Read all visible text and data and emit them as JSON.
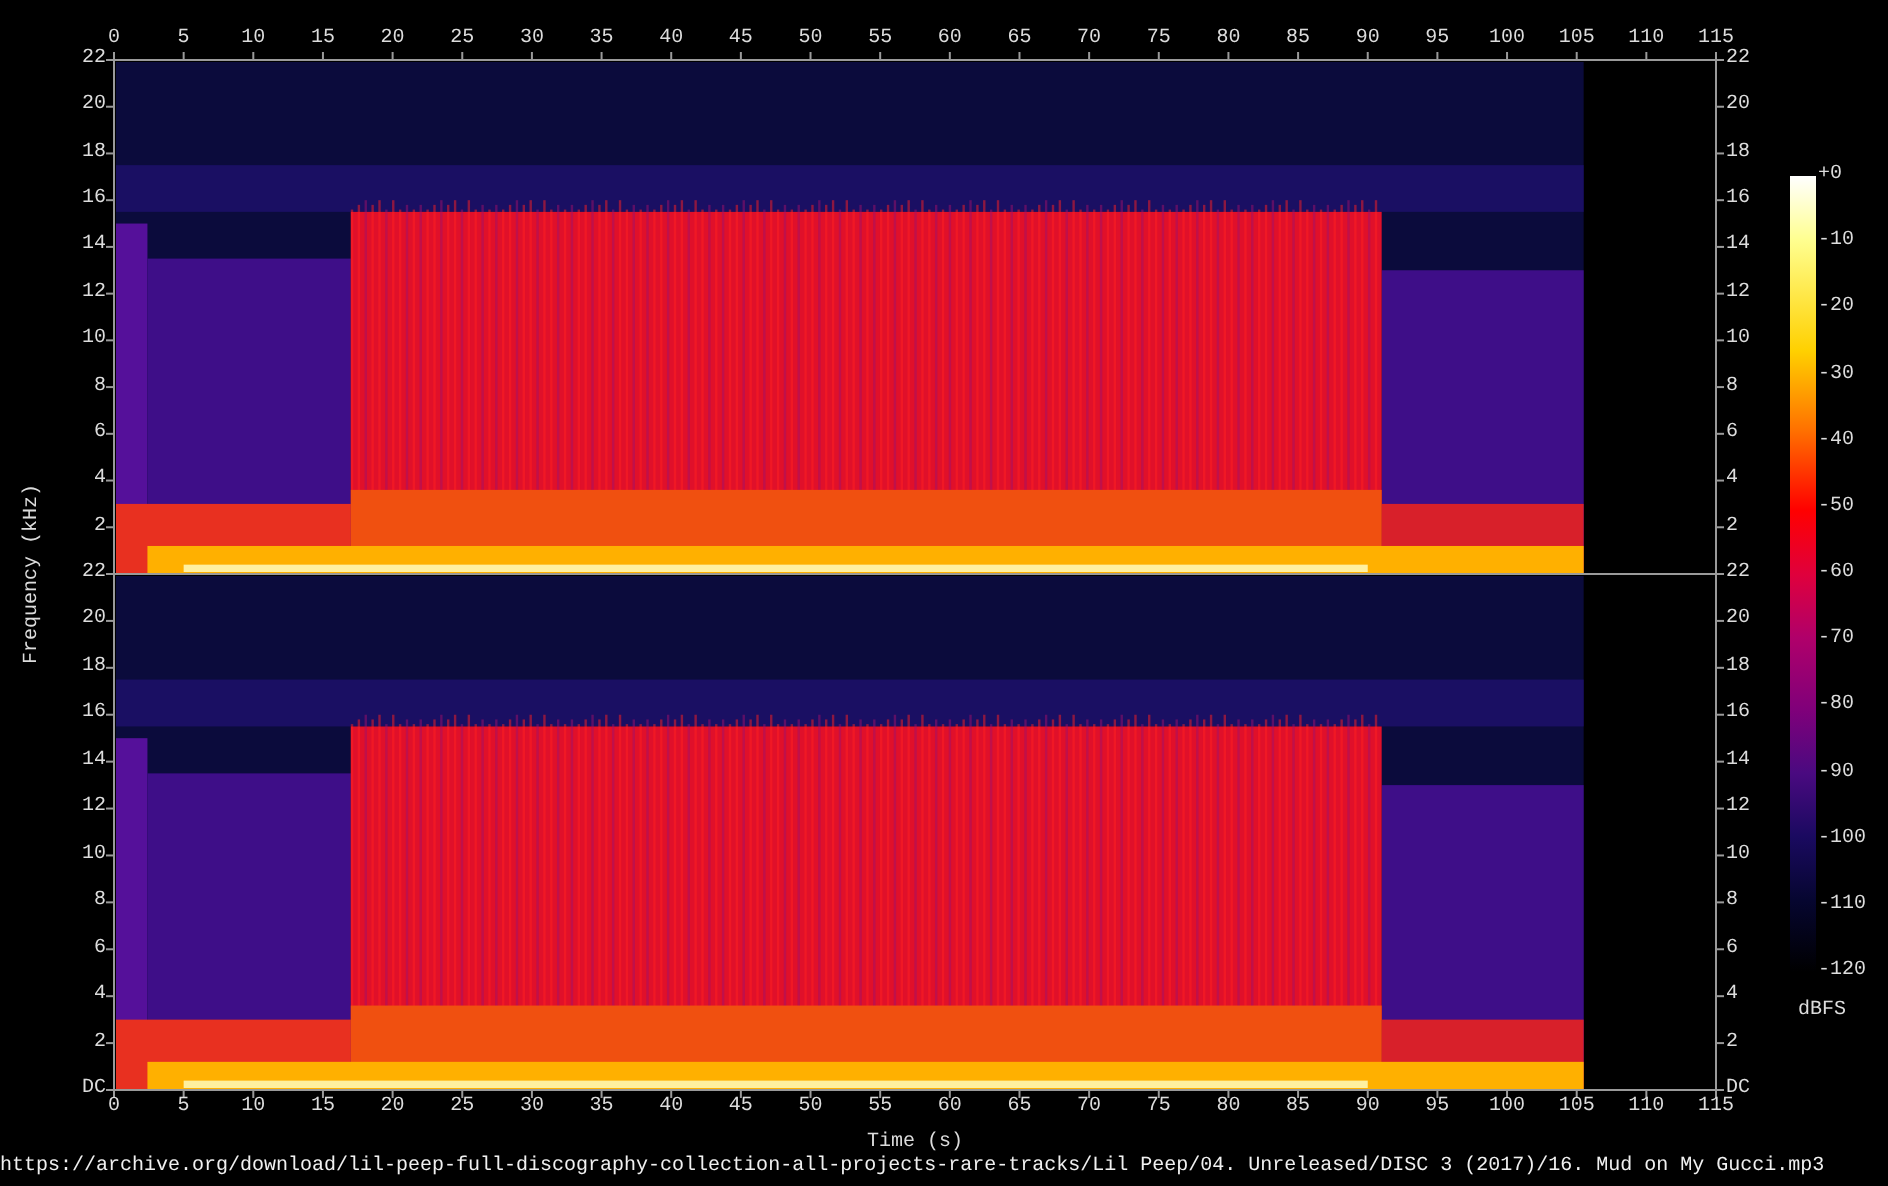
{
  "time_axis_top": {
    "ticks": [
      "0",
      "5",
      "10",
      "15",
      "20",
      "25",
      "30",
      "35",
      "40",
      "45",
      "50",
      "55",
      "60",
      "65",
      "70",
      "75",
      "80",
      "85",
      "90",
      "95",
      "100",
      "105",
      "110",
      "115"
    ]
  },
  "frequency_axis": {
    "label": "Frequency (kHz)",
    "channels": [
      {
        "left_ticks": [
          "22",
          "20",
          "18",
          "16",
          "14",
          "12",
          "10",
          "8",
          "6",
          "4",
          "2"
        ],
        "right_ticks": [
          "22",
          "20",
          "18",
          "16",
          "14",
          "12",
          "10",
          "8",
          "6",
          "4",
          "2"
        ]
      },
      {
        "left_ticks": [
          "22",
          "20",
          "18",
          "16",
          "14",
          "12",
          "10",
          "8",
          "6",
          "4",
          "2",
          "DC"
        ],
        "right_ticks": [
          "22",
          "20",
          "18",
          "16",
          "14",
          "12",
          "10",
          "8",
          "6",
          "4",
          "2",
          "DC"
        ]
      }
    ]
  },
  "colorbar": {
    "ticks": [
      "+0",
      "-10",
      "-20",
      "-30",
      "-40",
      "-50",
      "-60",
      "-70",
      "-80",
      "-90",
      "-100",
      "-110",
      "-120"
    ],
    "unit": "dBFS"
  },
  "time_axis_bottom": {
    "ticks": [
      "0",
      "5",
      "10",
      "15",
      "20",
      "25",
      "30",
      "35",
      "40",
      "45",
      "50",
      "55",
      "60",
      "65",
      "70",
      "75",
      "80",
      "85",
      "90",
      "95",
      "100",
      "105",
      "110",
      "115"
    ],
    "label": "Time (s)"
  },
  "caption": "https://archive.org/download/lil-peep-full-discography-collection-all-projects-rare-tracks/Lil Peep/04. Unreleased/DISC 3 (2017)/16. Mud on My Gucci.mp3"
}
